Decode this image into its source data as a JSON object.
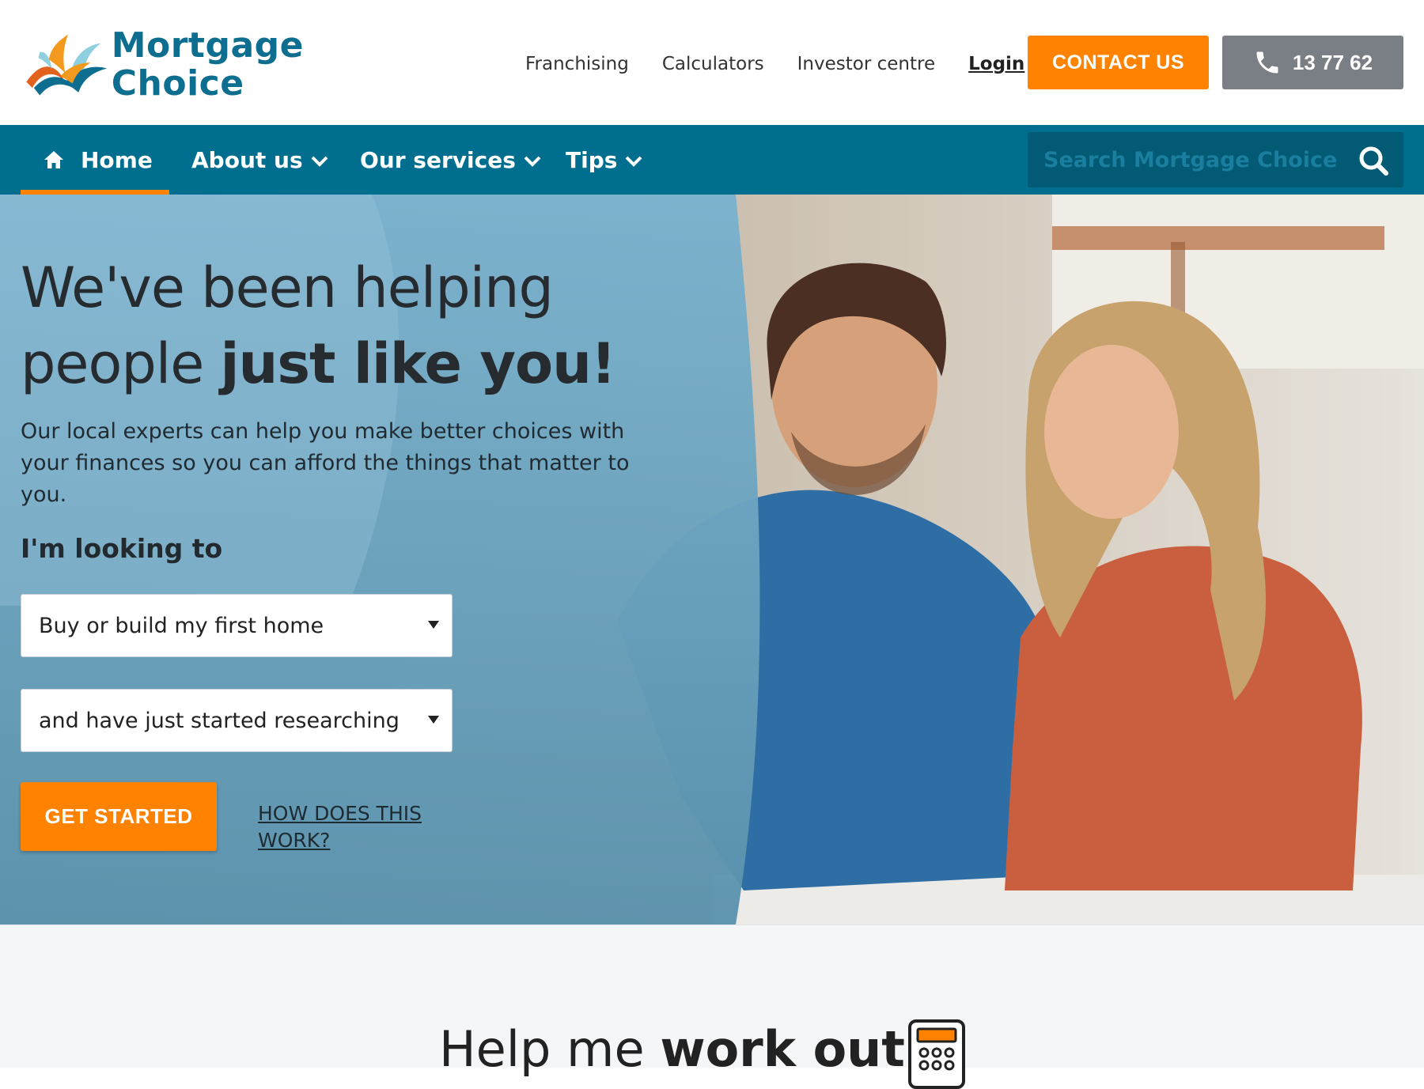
{
  "header": {
    "logo": {
      "line1": "Mortgage",
      "line2": "Choice",
      "icon": "mortgage-choice-logo-icon",
      "color": "#0e6e8f"
    },
    "top_links": [
      {
        "label": "Franchising"
      },
      {
        "label": "Calculators"
      },
      {
        "label": "Investor centre"
      },
      {
        "label": "Login"
      }
    ],
    "contact_label": "CONTACT US",
    "phone_label": "13 77 62",
    "phone_icon": "phone-icon",
    "accent_color": "#ff8200"
  },
  "nav": {
    "items": [
      {
        "label": "Home",
        "icon": "home-icon",
        "active": true
      },
      {
        "label": "About us",
        "icon": "chevron-down-icon"
      },
      {
        "label": "Our services",
        "icon": "chevron-down-icon"
      },
      {
        "label": "Tips",
        "icon": "chevron-down-icon"
      }
    ],
    "search_placeholder": "Search Mortgage Choice",
    "search_icon": "search-icon",
    "bar_color": "#006f8f"
  },
  "hero": {
    "title_prefix": "We've been helping",
    "title_line2_prefix": "people ",
    "title_bold": "just like you!",
    "subtitle": "Our local experts can help you make better choices with your finances so you can afford the things that matter to you.",
    "looking_label": "I'm looking to",
    "select1_value": "Buy or build my first home",
    "select2_value": "and have just started researching",
    "cta_label": "GET STARTED",
    "how_link": "HOW DOES THIS WORK?"
  },
  "lower": {
    "help_prefix": "Help me ",
    "help_bold": "work out...",
    "icon": "calculator-icon"
  }
}
